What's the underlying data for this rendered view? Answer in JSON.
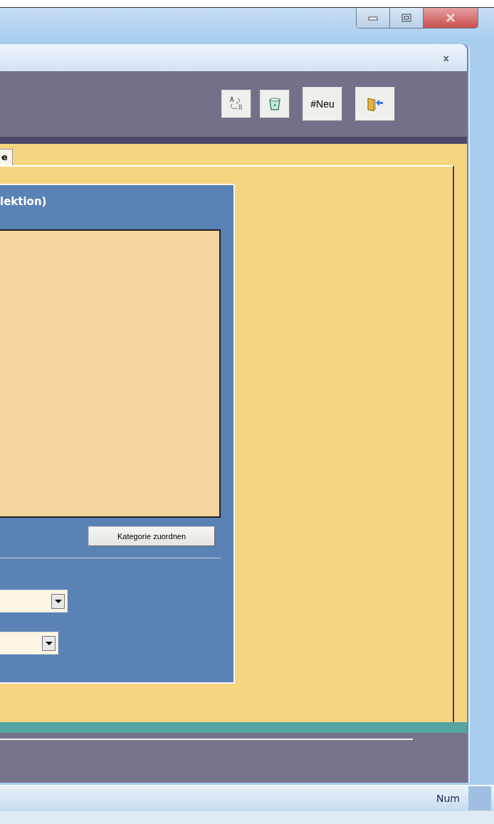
{
  "window": {
    "controls": [
      {
        "kind": "minimize"
      },
      {
        "kind": "maximize"
      },
      {
        "kind": "close"
      }
    ]
  },
  "inner_window": {
    "close_label": "x"
  },
  "toolbar": {
    "sort_from": "A",
    "sort_to": "B",
    "new_label": "#Neu"
  },
  "tabs": [
    {
      "label": "e",
      "selected": true
    }
  ],
  "panel": {
    "title": "lektion)",
    "assign_button": "Kategorie zuordnen"
  },
  "status_bar": {
    "num": "Num"
  }
}
